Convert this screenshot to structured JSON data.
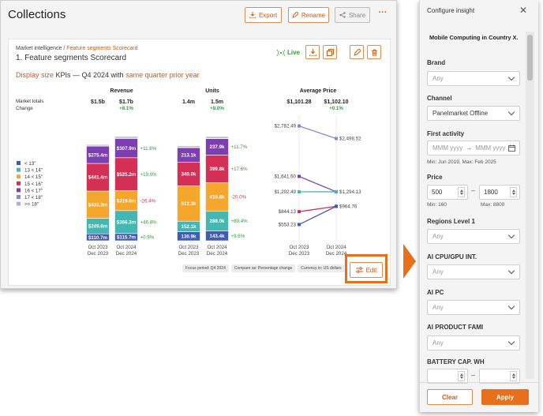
{
  "main": {
    "title": "Collections",
    "buttons": {
      "export": "Export",
      "rename": "Rename",
      "share": "Share",
      "more": "···"
    },
    "card": {
      "breadcrumb_root": "Market intelligence",
      "breadcrumb_sep": " / ",
      "breadcrumb_link": "Feature segments Scorecard",
      "title": "1. Feature segments Scorecard",
      "live": "Live",
      "subhead": {
        "part1": "Display size",
        "part2": " KPIs — Q4 2024 with ",
        "part3": "same quarter prior year"
      },
      "chips": [
        "Focus period: Q4 2024",
        "Compare as: Percentage change",
        "Currency in: US dollars"
      ],
      "edit": "Edit"
    }
  },
  "chart_data": {
    "type": "bar",
    "row_labels": {
      "totals": "Market totals",
      "change": "Change"
    },
    "legend": [
      {
        "name": "< 13\"",
        "color": "#3f5bb5"
      },
      {
        "name": "13 < 14\"",
        "color": "#44b7b0"
      },
      {
        "name": "14 < 15\"",
        "color": "#f5a62c"
      },
      {
        "name": "15 < 16\"",
        "color": "#d42f55"
      },
      {
        "name": "16 < 17\"",
        "color": "#7c3fb0"
      },
      {
        "name": "17 < 18\"",
        "color": "#7e8fd1"
      },
      {
        "name": ">= 18\"",
        "color": "#b9addc"
      }
    ],
    "categories": [
      "Oct 2023\nDec 2023",
      "Oct 2024\nDec 2024"
    ],
    "x_labels": [
      [
        "Oct 2023",
        "Dec 2023"
      ],
      [
        "Oct 2024",
        "Dec 2024"
      ]
    ],
    "panels": [
      {
        "title": "Revenue",
        "totals": [
          "$1.5b",
          "$1.7b"
        ],
        "change": "+8.1%",
        "bar_labels": [
          [
            "$110.7m",
            "$249.6m",
            "$433.3m",
            "$441.4m",
            "$275.4m",
            "",
            ""
          ],
          [
            "$115.7m",
            "$366.3m",
            "$319.0m",
            "$525.2m",
            "$307.9m",
            "",
            ""
          ]
        ],
        "values": [
          [
            110.7,
            249.6,
            433.3,
            441.4,
            275.4,
            5,
            20
          ],
          [
            115.7,
            366.3,
            319.0,
            525.2,
            307.9,
            5,
            25
          ]
        ],
        "segment_changes": [
          "+0.9%",
          "+46.8%",
          "-26.4%",
          "+19.0%",
          "+11.8%"
        ]
      },
      {
        "title": "Units",
        "totals": [
          "1.4m",
          "1.5m"
        ],
        "change": "+8.0%",
        "bar_labels": [
          [
            "130.9k",
            "152.1k",
            "513.3k",
            "340.0k",
            "213.1k",
            "",
            ""
          ],
          [
            "143.4k",
            "288.0k",
            "410.8k",
            "399.8k",
            "237.9k",
            "",
            ""
          ]
        ],
        "values": [
          [
            130.9,
            152.1,
            513.3,
            340.0,
            213.1,
            5,
            20
          ],
          [
            143.4,
            288.0,
            410.8,
            399.8,
            237.9,
            5,
            25
          ]
        ],
        "segment_changes": [
          "+9.6%",
          "+89.4%",
          "-20.0%",
          "+17.6%",
          "+11.7%"
        ]
      },
      {
        "title": "Average Price",
        "totals": [
          "$1,101.28",
          "$1,102.10"
        ],
        "change": "+0.1%",
        "type": "line",
        "ylim": [
          400,
          2900
        ],
        "series": [
          {
            "color": "#7e8fd1",
            "values": [
              2782.49,
              2498.52
            ],
            "labels": [
              "$2,782.49",
              "$2,498.52"
            ]
          },
          {
            "color": "#7c3fb0",
            "values": [
              1641.6,
              1294.13
            ],
            "labels": [
              "$1,641.60",
              ""
            ]
          },
          {
            "color": "#44b7b0",
            "values": [
              1292.49,
              1294.13
            ],
            "labels": [
              "$1,292.49",
              "$1,294.13"
            ]
          },
          {
            "color": "#d42f55",
            "values": [
              844.13,
              964.76
            ],
            "labels": [
              "$844.13",
              ""
            ]
          },
          {
            "color": "#3f5bb5",
            "values": [
              553.23,
              964.76
            ],
            "labels": [
              "$553.23",
              "$964.76"
            ]
          }
        ]
      }
    ]
  },
  "panel": {
    "title": "Configure insight",
    "subtitle": "Mobile Computing in Country X.",
    "fields": [
      {
        "label": "Brand",
        "value": "Any",
        "selected": false
      },
      {
        "label": "Channel",
        "value": "Panelmarket Offline",
        "selected": true
      }
    ],
    "first_activity": {
      "label": "First activity",
      "from": "MMM yyyy",
      "to": "MMM yyyy",
      "hint": "Min: Jun 2019, Max: Feb 2025"
    },
    "price": {
      "label": "Price",
      "min": "500",
      "max": "1800",
      "hint_min": "Min: 160",
      "hint_max": "Max: 8800"
    },
    "more_fields": [
      {
        "label": "Regions Level 1",
        "value": "Any"
      },
      {
        "label": "AI CPU/GPU INT.",
        "value": "Any"
      },
      {
        "label": "AI PC",
        "value": "Any"
      },
      {
        "label": "AI PRODUCT FAMI",
        "value": "Any"
      }
    ],
    "battery": {
      "label": "BATTERY CAP. WH"
    },
    "clear": "Clear",
    "apply": "Apply"
  }
}
